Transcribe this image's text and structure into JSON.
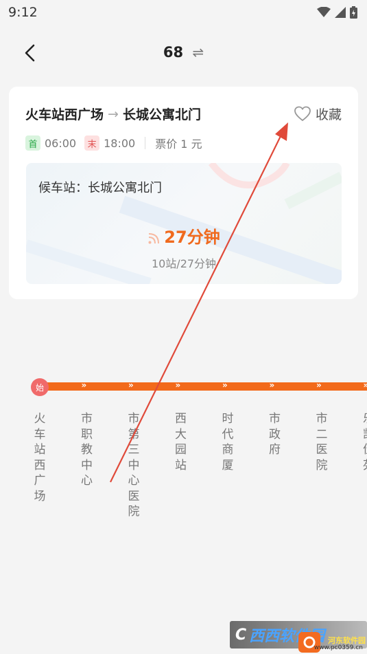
{
  "status_bar": {
    "time": "9:12"
  },
  "nav": {
    "route_number": "68",
    "swap_symbol": "⇌"
  },
  "card": {
    "origin": "火车站西广场",
    "arrow": "→",
    "destination": "长城公寓北门",
    "favorite_label": "收藏",
    "first_tag": "首",
    "first_time": "06:00",
    "last_tag": "末",
    "last_time": "18:00",
    "fare": "票价 1 元",
    "waiting_station": "候车站：长城公寓北门",
    "eta": "27分钟",
    "eta_detail": "10站/27分钟"
  },
  "line": {
    "start_badge": "始",
    "stations": [
      "火车站西广场",
      "市职教中心",
      "市第三中心医院",
      "西大园站",
      "时代商厦",
      "市政府",
      "市二医院",
      "乐凯佳苑"
    ],
    "colors": {
      "line": "#f26a1b",
      "start": "#f06a6a"
    }
  },
  "watermark": {
    "logo_prefix": "C",
    "logo_main": "西西软件园",
    "sub": "河东软件园",
    "url": "www.pc0359.cn"
  }
}
